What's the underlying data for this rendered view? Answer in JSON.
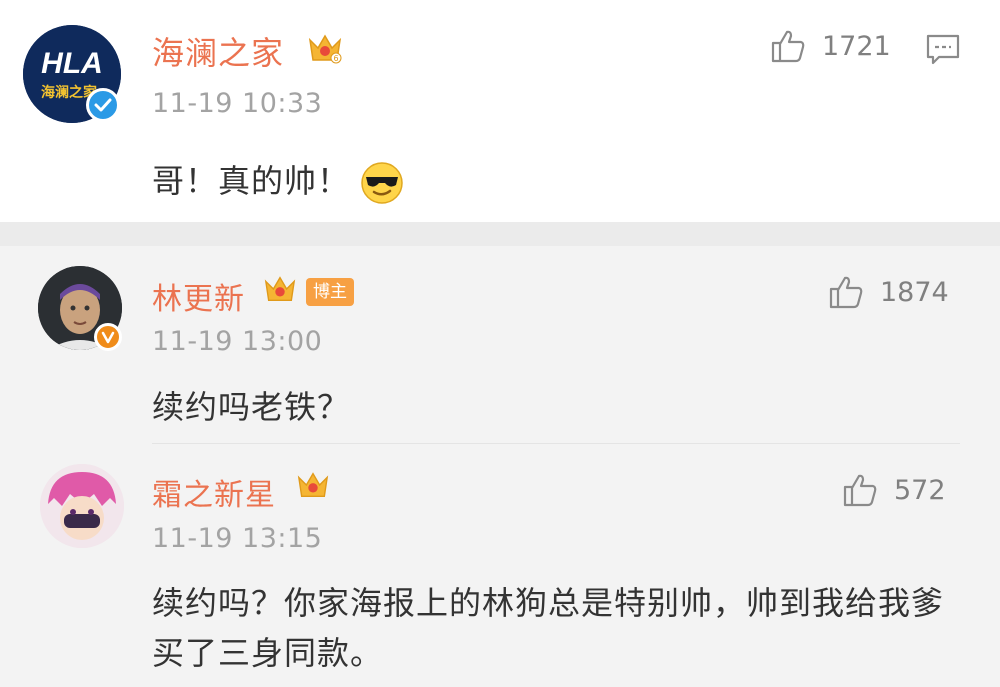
{
  "main_comment": {
    "avatar_text": "HLA",
    "avatar_subtext": "海澜之家",
    "username": "海澜之家",
    "time": "11-19 10:33",
    "content": "哥！真的帅！",
    "likes": "1721",
    "emoji": "sunglasses-emoji"
  },
  "replies": [
    {
      "username": "林更新",
      "badge": "博主",
      "time": "11-19 13:00",
      "content": "续约吗老铁？",
      "likes": "1874"
    },
    {
      "username": "霜之新星",
      "time": "11-19 13:15",
      "content": "续约吗？你家海报上的林狗总是特别帅，帅到我给我爹买了三身同款。",
      "likes": "572"
    }
  ],
  "colors": {
    "username": "#eb7350",
    "time": "#a3a3a3",
    "content": "#333333",
    "verify_blue": "#2b9ae6",
    "verify_orange": "#f08c1a",
    "crown": "#f5b533",
    "separator": "#ebebeb",
    "reply_bg": "#f3f3f3"
  }
}
